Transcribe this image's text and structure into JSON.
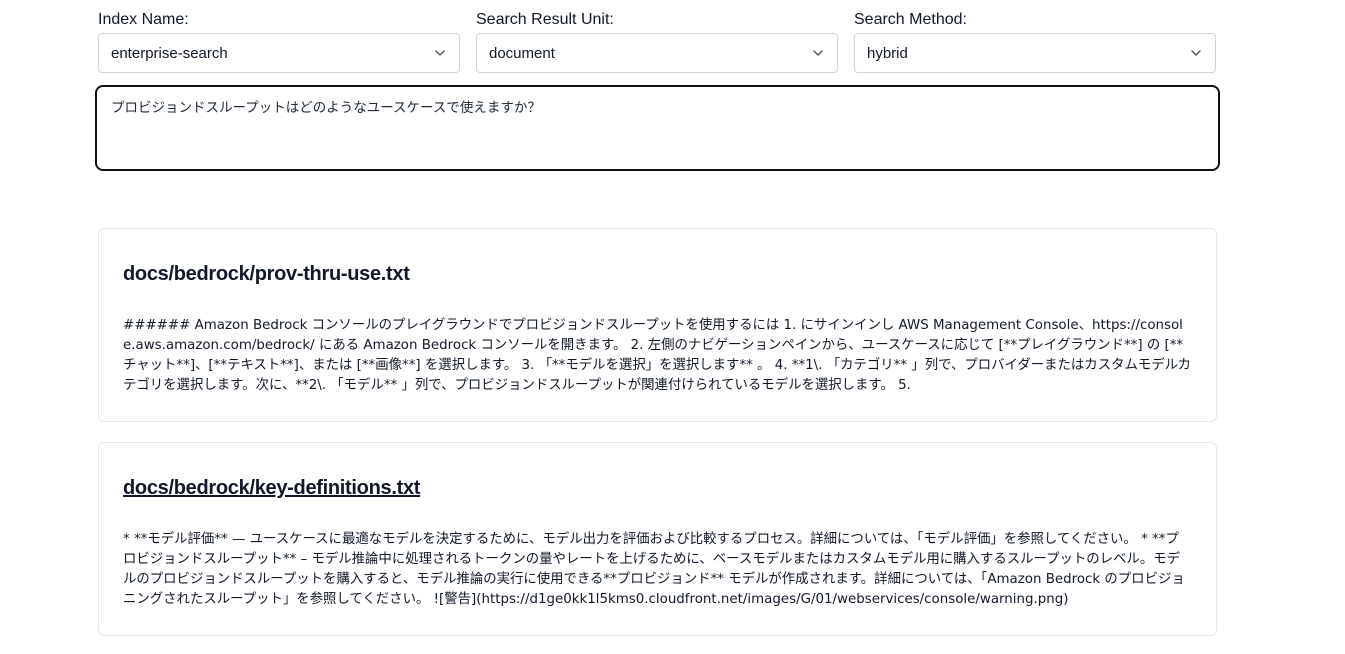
{
  "fields": {
    "index": {
      "label": "Index Name:",
      "value": "enterprise-search"
    },
    "unit": {
      "label": "Search Result Unit:",
      "value": "document"
    },
    "method": {
      "label": "Search Method:",
      "value": "hybrid"
    }
  },
  "query": {
    "value": "プロビジョンドスループットはどのようなユースケースで使えますか？"
  },
  "results": [
    {
      "title": "docs/bedrock/prov-thru-use.txt",
      "body": "###### Amazon Bedrock コンソールのプレイグラウンドでプロビジョンドスループットを使用するには 1. にサインインし AWS Management Console、https://console.aws.amazon.com/bedrock/ にある Amazon Bedrock コンソールを開きます。 2. 左側のナビゲーションペインから、ユースケースに応じて [**プレイグラウンド**] の [**チャット**]、[**テキスト**]、または [**画像**] を選択します。 3. 「**モデルを選択」を選択します** 。 4. **1\\. 「カテゴリ** 」列で、プロバイダーまたはカスタムモデルカテゴリを選択します。次に、**2\\. 「モデル** 」列で、プロビジョンドスループットが関連付けられているモデルを選択します。 5."
    },
    {
      "title": "docs/bedrock/key-definitions.txt",
      "body": "* **モデル評価** — ユースケースに最適なモデルを決定するために、モデル出力を評価および比較するプロセス。詳細については、「モデル評価」を参照してください。 * **プロビジョンドスループット** – モデル推論中に処理されるトークンの量やレートを上げるために、ベースモデルまたはカスタムモデル用に購入するスループットのレベル。モデルのプロビジョンドスループットを購入すると、モデル推論の実行に使用できる**プロビジョンド** モデルが作成されます。詳細については、「Amazon Bedrock のプロビジョニングされたスループット」を参照してください。 ![警告](https://d1ge0kk1l5kms0.cloudfront.net/images/G/01/webservices/console/warning.png)"
    }
  ],
  "icons": {
    "select_chevron": "chevron-down-icon"
  }
}
